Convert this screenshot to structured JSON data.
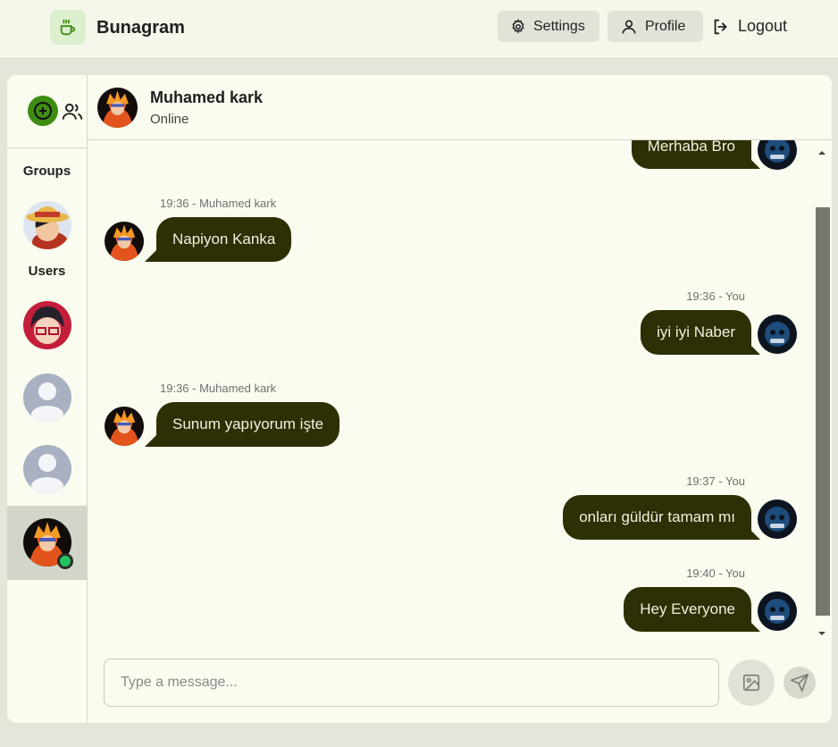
{
  "app": {
    "name": "Bunagram",
    "logo_icon": "coffee-cup-icon",
    "accent": "#3f8c12"
  },
  "nav": {
    "settings_label": "Settings",
    "profile_label": "Profile",
    "logout_label": "Logout"
  },
  "sidebar": {
    "groups_label": "Groups",
    "users_label": "Users",
    "groups": [
      {
        "avatar": "straw-hat-character-avatar"
      }
    ],
    "users": [
      {
        "avatar": "red-hair-glasses-character-avatar",
        "active": false,
        "online": false
      },
      {
        "avatar": "default-user-avatar",
        "active": false,
        "online": false
      },
      {
        "avatar": "default-user-avatar",
        "active": false,
        "online": false
      },
      {
        "avatar": "orange-hair-character-avatar",
        "active": true,
        "online": true
      }
    ]
  },
  "chat": {
    "contact_name": "Muhamed kark",
    "contact_status": "Online",
    "messages": [
      {
        "direction": "out",
        "meta": "",
        "text": "Merhaba Bro"
      },
      {
        "direction": "in",
        "meta": "19:36 - Muhamed kark",
        "text": "Napiyon Kanka"
      },
      {
        "direction": "out",
        "meta": "19:36 - You",
        "text": "iyi iyi Naber"
      },
      {
        "direction": "in",
        "meta": "19:36 - Muhamed kark",
        "text": "Sunum yapıyorum işte"
      },
      {
        "direction": "out",
        "meta": "19:37 - You",
        "text": "onları güldür tamam mı"
      },
      {
        "direction": "out",
        "meta": "19:40 - You",
        "text": "Hey Everyone"
      }
    ]
  },
  "composer": {
    "placeholder": "Type a message...",
    "value": ""
  },
  "colors": {
    "bubble": "#2e2f05",
    "page_bg": "#e3e6da",
    "panel_bg": "#f9fcef",
    "online": "#22c55e"
  }
}
